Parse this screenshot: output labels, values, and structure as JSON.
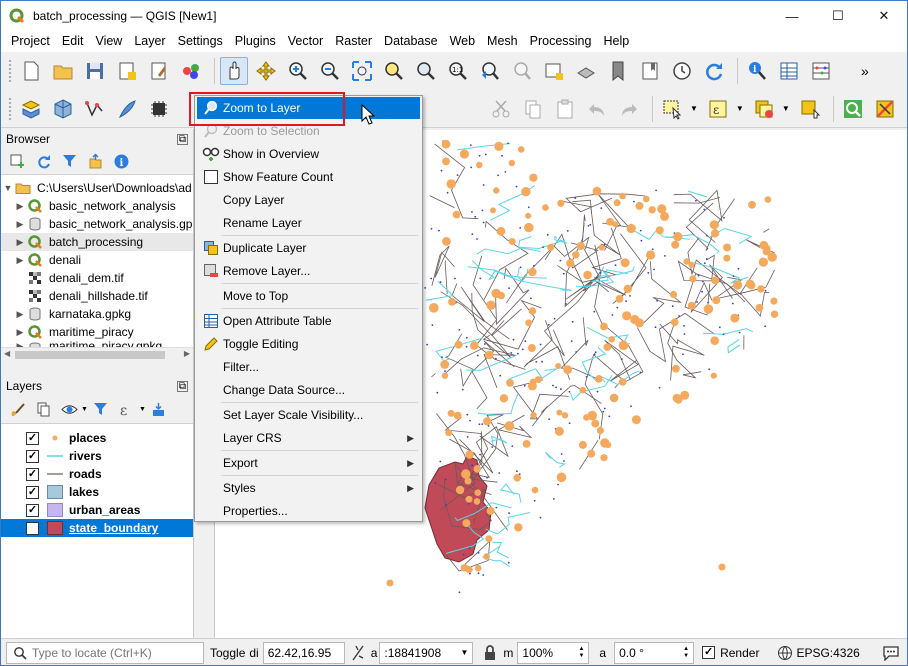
{
  "window": {
    "title": "batch_processing — QGIS [New1]",
    "minimize": "—",
    "maximize": "☐",
    "close": "✕"
  },
  "menubar": [
    "Project",
    "Edit",
    "View",
    "Layer",
    "Settings",
    "Plugins",
    "Vector",
    "Raster",
    "Database",
    "Web",
    "Mesh",
    "Processing",
    "Help"
  ],
  "toolbar_overflow": "»",
  "browser": {
    "title": "Browser",
    "items": [
      {
        "label": "C:\\Users\\User\\Downloads\\ad",
        "icon": "folder-icon",
        "expanded": true
      },
      {
        "label": "basic_network_analysis",
        "icon": "qgis-project-icon"
      },
      {
        "label": "basic_network_analysis.gp",
        "icon": "geopackage-icon"
      },
      {
        "label": "batch_processing",
        "icon": "qgis-project-icon",
        "selected": true
      },
      {
        "label": "denali",
        "icon": "qgis-project-icon"
      },
      {
        "label": "denali_dem.tif",
        "icon": "raster-icon"
      },
      {
        "label": "denali_hillshade.tif",
        "icon": "raster-icon"
      },
      {
        "label": "karnataka.gpkg",
        "icon": "geopackage-icon"
      },
      {
        "label": "maritime_piracy",
        "icon": "qgis-project-icon"
      },
      {
        "label": "maritime_piracy.gpkg",
        "icon": "geopackage-icon"
      }
    ]
  },
  "layers": {
    "title": "Layers",
    "items": [
      {
        "label": "places",
        "symbol": "point",
        "color": "#f5a95d",
        "checked": true
      },
      {
        "label": "rivers",
        "symbol": "line",
        "color": "#5ad6e6",
        "checked": true
      },
      {
        "label": "roads",
        "symbol": "line",
        "color": "#6a5a5a",
        "checked": true
      },
      {
        "label": "lakes",
        "symbol": "fill",
        "color": "#a8c8dc",
        "checked": true
      },
      {
        "label": "urban_areas",
        "symbol": "fill",
        "color": "#c8b4f0",
        "checked": true
      },
      {
        "label": "state_boundary",
        "symbol": "fill",
        "color": "#c04a58",
        "checked": true,
        "selected": true
      }
    ]
  },
  "context_menu": {
    "items": [
      {
        "label": "Zoom to Layer",
        "icon": "zoom-layer-icon",
        "highlighted": true
      },
      {
        "label": "Zoom to Selection",
        "icon": "zoom-selection-icon",
        "disabled": true
      },
      {
        "label": "Show in Overview",
        "icon": "overview-icon"
      },
      {
        "label": "Show Feature Count",
        "icon": "checkbox-icon"
      },
      {
        "label": "Copy Layer",
        "icon": ""
      },
      {
        "label": "Rename Layer",
        "icon": ""
      },
      {
        "label": "Duplicate Layer",
        "icon": "duplicate-icon"
      },
      {
        "label": "Remove Layer...",
        "icon": "remove-layer-icon"
      },
      {
        "label": "Move to Top",
        "icon": ""
      },
      {
        "label": "Open Attribute Table",
        "icon": "table-icon"
      },
      {
        "label": "Toggle Editing",
        "icon": "pencil-icon"
      },
      {
        "label": "Filter...",
        "icon": ""
      },
      {
        "label": "Change Data Source...",
        "icon": ""
      },
      {
        "label": "Set Layer Scale Visibility...",
        "icon": ""
      },
      {
        "label": "Layer CRS",
        "icon": "",
        "submenu": true
      },
      {
        "label": "Export",
        "icon": "",
        "submenu": true
      },
      {
        "label": "Styles",
        "icon": "",
        "submenu": true
      },
      {
        "label": "Properties...",
        "icon": ""
      }
    ]
  },
  "statusbar": {
    "locate_placeholder": "Type to locate (Ctrl+K)",
    "toggle_label": "Toggle",
    "coordinate_label": "di",
    "coordinate": "62.42,16.95",
    "scale_label": "a",
    "scale": ":18841908",
    "magnifier": "100%",
    "rotation_label": "a",
    "rotation": "0.0 °",
    "render_label": "Render",
    "crs": "EPSG:4326"
  },
  "colors": {
    "highlight": "#0078d7",
    "annotation_box": "#e0191f",
    "places": "#f5a95d",
    "rivers": "#5ad6e6",
    "roads": "#6a5a5a",
    "state_boundary": "#c04a58"
  }
}
